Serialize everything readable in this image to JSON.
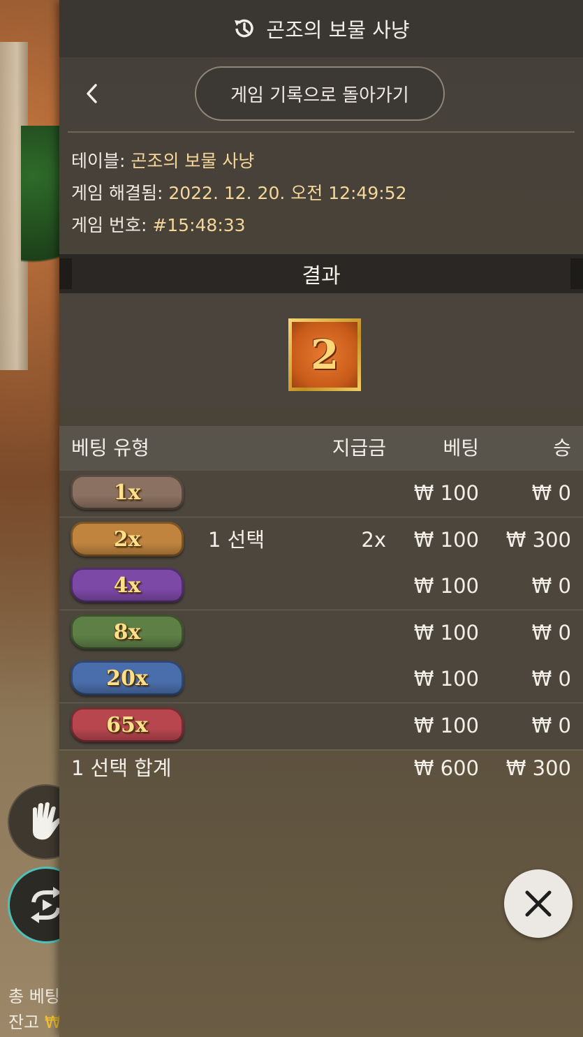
{
  "header": {
    "title": "곤조의 보물 사냥",
    "icon": "history-icon"
  },
  "nav": {
    "return_label": "게임 기록으로 돌아가기"
  },
  "info": {
    "table_label": "테이블: ",
    "table_value": "곤조의 보물 사냥",
    "resolved_label": "게임 해결됨: ",
    "resolved_value": "2022. 12. 20. 오전 12:49:52",
    "number_label": "게임 번호: ",
    "number_value": "#15:48:33"
  },
  "result": {
    "title": "결과",
    "number": "2"
  },
  "table": {
    "headers": {
      "type": "베팅 유형",
      "payout": "지급금",
      "bet": "베팅",
      "win": "승"
    },
    "rows": [
      {
        "badge": "1x",
        "selection": "",
        "payout": "",
        "bet": "₩ 100",
        "win": "₩ 0",
        "color": "#8a7161"
      },
      {
        "badge": "2x",
        "selection": "1 선택",
        "payout": "2x",
        "bet": "₩ 100",
        "win": "₩ 300",
        "color": "#c0843e"
      },
      {
        "badge": "4x",
        "selection": "",
        "payout": "",
        "bet": "₩ 100",
        "win": "₩ 0",
        "color": "#7d49a7"
      },
      {
        "badge": "8x",
        "selection": "",
        "payout": "",
        "bet": "₩ 100",
        "win": "₩ 0",
        "color": "#5e7f46"
      },
      {
        "badge": "20x",
        "selection": "",
        "payout": "",
        "bet": "₩ 100",
        "win": "₩ 0",
        "color": "#4a6eab"
      },
      {
        "badge": "65x",
        "selection": "",
        "payout": "",
        "bet": "₩ 100",
        "win": "₩ 0",
        "color": "#b8464f"
      }
    ],
    "total": {
      "label": "1 선택 합계",
      "bet": "₩ 600",
      "win": "₩ 300"
    }
  },
  "background": {
    "total_bet_label": "총 베팅",
    "balance_label": "잔고",
    "balance_currency": "₩"
  }
}
